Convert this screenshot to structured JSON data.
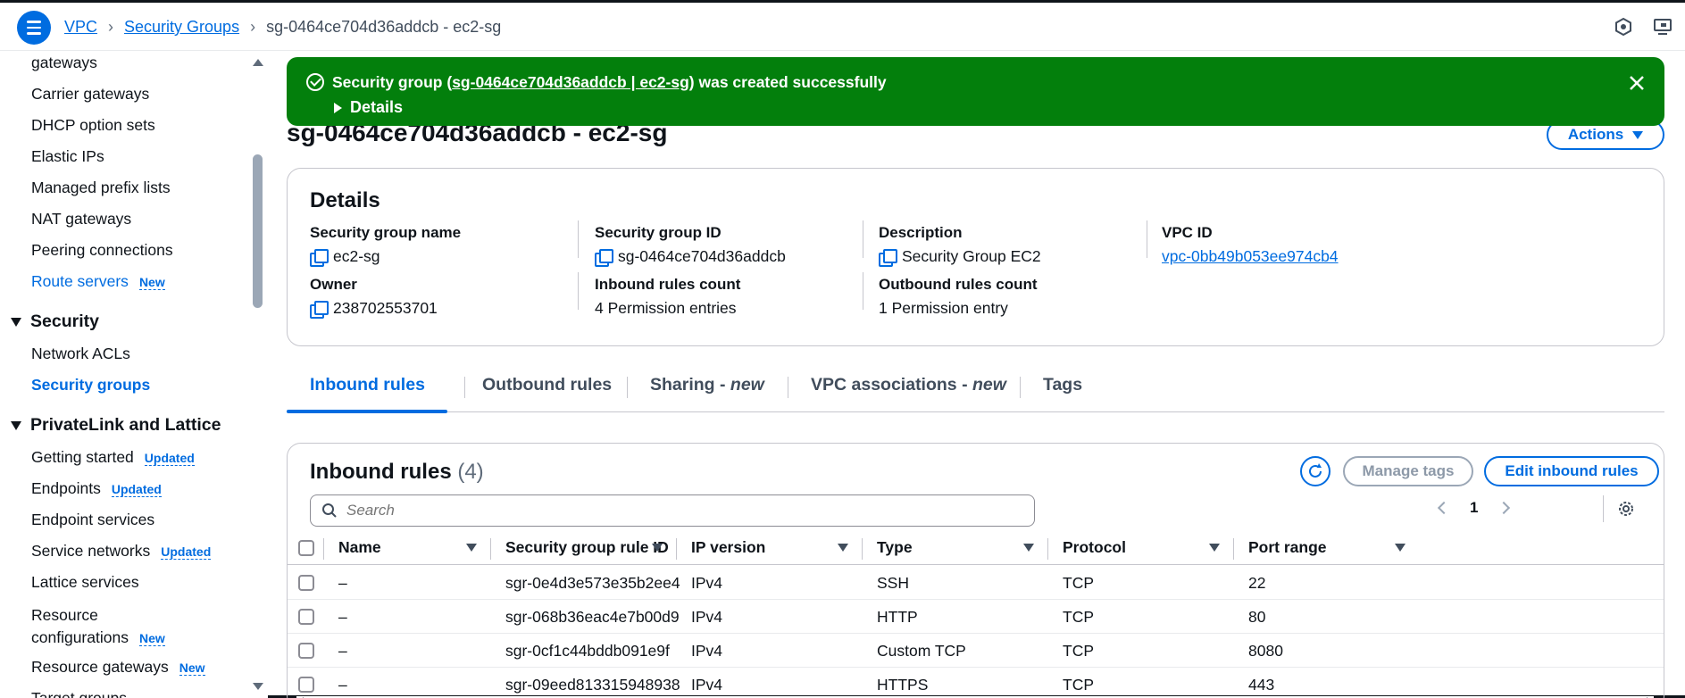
{
  "breadcrumb": {
    "items": [
      "VPC",
      "Security Groups"
    ],
    "current": "sg-0464ce704d36addcb - ec2-sg"
  },
  "sidebar": {
    "items_top": [
      {
        "label": "gateways"
      },
      {
        "label": "Carrier gateways"
      },
      {
        "label": "DHCP option sets"
      },
      {
        "label": "Elastic IPs"
      },
      {
        "label": "Managed prefix lists"
      },
      {
        "label": "NAT gateways"
      },
      {
        "label": "Peering connections"
      },
      {
        "label": "Route servers",
        "badge": "New"
      }
    ],
    "security_section": "Security",
    "security_items": [
      "Network ACLs",
      "Security groups"
    ],
    "privatelink_section": "PrivateLink and Lattice",
    "privatelink_items": [
      {
        "label": "Getting started",
        "badge": "Updated"
      },
      {
        "label": "Endpoints",
        "badge": "Updated"
      },
      {
        "label": "Endpoint services"
      },
      {
        "label": "Service networks",
        "badge": "Updated"
      },
      {
        "label": "Lattice services"
      },
      {
        "label": "Resource",
        "label2": "configurations",
        "badge": "New"
      },
      {
        "label": "Resource gateways",
        "badge": "New"
      },
      {
        "label": "Target groups"
      }
    ]
  },
  "flash": {
    "prefix": "Security group (",
    "link": "sg-0464ce704d36addcb | ec2-sg",
    "suffix": ") was created successfully",
    "details_label": "Details"
  },
  "page": {
    "title": "sg-0464ce704d36addcb - ec2-sg",
    "actions_label": "Actions"
  },
  "details": {
    "title": "Details",
    "fields": {
      "sg_name": {
        "label": "Security group name",
        "value": "ec2-sg"
      },
      "sg_id": {
        "label": "Security group ID",
        "value": "sg-0464ce704d36addcb"
      },
      "description": {
        "label": "Description",
        "value": "Security Group EC2"
      },
      "vpc_id": {
        "label": "VPC ID",
        "value": "vpc-0bb49b053ee974cb4"
      },
      "owner": {
        "label": "Owner",
        "value": "238702553701"
      },
      "inbound_count": {
        "label": "Inbound rules count",
        "value": "4 Permission entries"
      },
      "outbound_count": {
        "label": "Outbound rules count",
        "value": "1 Permission entry"
      }
    }
  },
  "tabs": {
    "inbound": "Inbound rules",
    "outbound": "Outbound rules",
    "sharing": "Sharing - ",
    "sharing_new": "new",
    "vpc_assoc": "VPC associations - ",
    "vpc_assoc_new": "new",
    "tags": "Tags"
  },
  "rules": {
    "title": "Inbound rules",
    "count": "(4)",
    "manage_tags": "Manage tags",
    "edit_label": "Edit inbound rules",
    "search_placeholder": "Search",
    "page": "1",
    "columns": [
      "Name",
      "Security group rule ID",
      "IP version",
      "Type",
      "Protocol",
      "Port range"
    ],
    "rows": [
      [
        "–",
        "sgr-0e4d3e573e35b2ee4",
        "IPv4",
        "SSH",
        "TCP",
        "22"
      ],
      [
        "–",
        "sgr-068b36eac4e7b00d9",
        "IPv4",
        "HTTP",
        "TCP",
        "80"
      ],
      [
        "–",
        "sgr-0cf1c44bddb091e9f",
        "IPv4",
        "Custom TCP",
        "TCP",
        "8080"
      ],
      [
        "–",
        "sgr-09eed813315948938",
        "IPv4",
        "HTTPS",
        "TCP",
        "443"
      ]
    ]
  },
  "colors": {
    "accent": "#006ce0",
    "success": "#037f0c"
  }
}
